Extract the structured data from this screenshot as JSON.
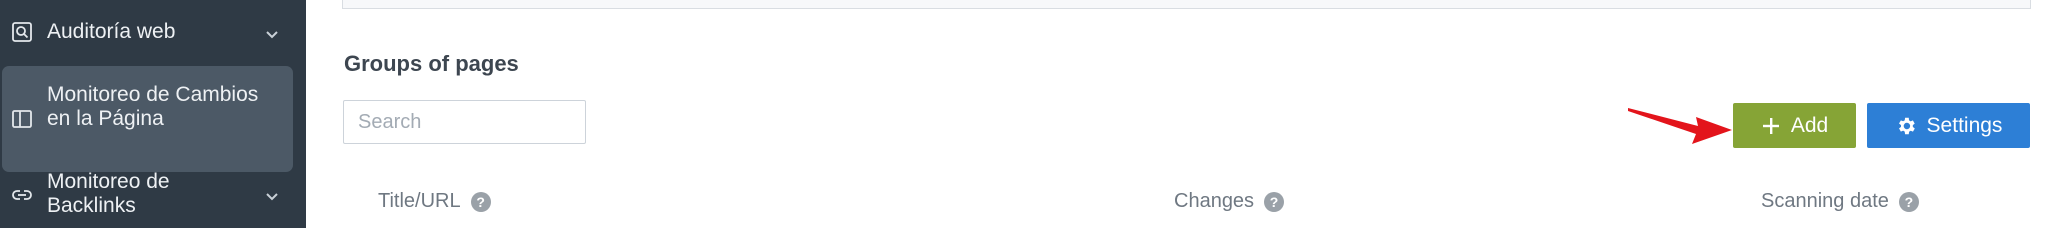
{
  "sidebar": {
    "items": [
      {
        "label": "Auditoría web",
        "icon": "search-document-icon",
        "expandable": true
      },
      {
        "label_line1": "Monitoreo de Cambios",
        "label_line2": "en la Página",
        "icon": "book-icon",
        "active": true
      },
      {
        "label_line1": "Monitoreo de",
        "label_line2": "Backlinks",
        "icon": "link-icon",
        "expandable": true
      }
    ]
  },
  "main": {
    "section_title": "Groups of pages",
    "search": {
      "placeholder": "Search",
      "value": ""
    },
    "buttons": {
      "add": {
        "label": "Add",
        "icon": "plus-icon",
        "color": "#86a436"
      },
      "settings": {
        "label": "Settings",
        "icon": "gear-icon",
        "color": "#2d7fd6"
      }
    },
    "annotation_arrow_color": "#e3141b",
    "table": {
      "columns": [
        {
          "label": "Title/URL",
          "help_icon": "question-icon"
        },
        {
          "label": "Changes",
          "help_icon": "question-icon"
        },
        {
          "label": "Scanning date",
          "help_icon": "question-icon"
        }
      ]
    }
  },
  "colors": {
    "sidebar_bg": "#2f3a45",
    "sidebar_active_bg": "#4c5966"
  }
}
